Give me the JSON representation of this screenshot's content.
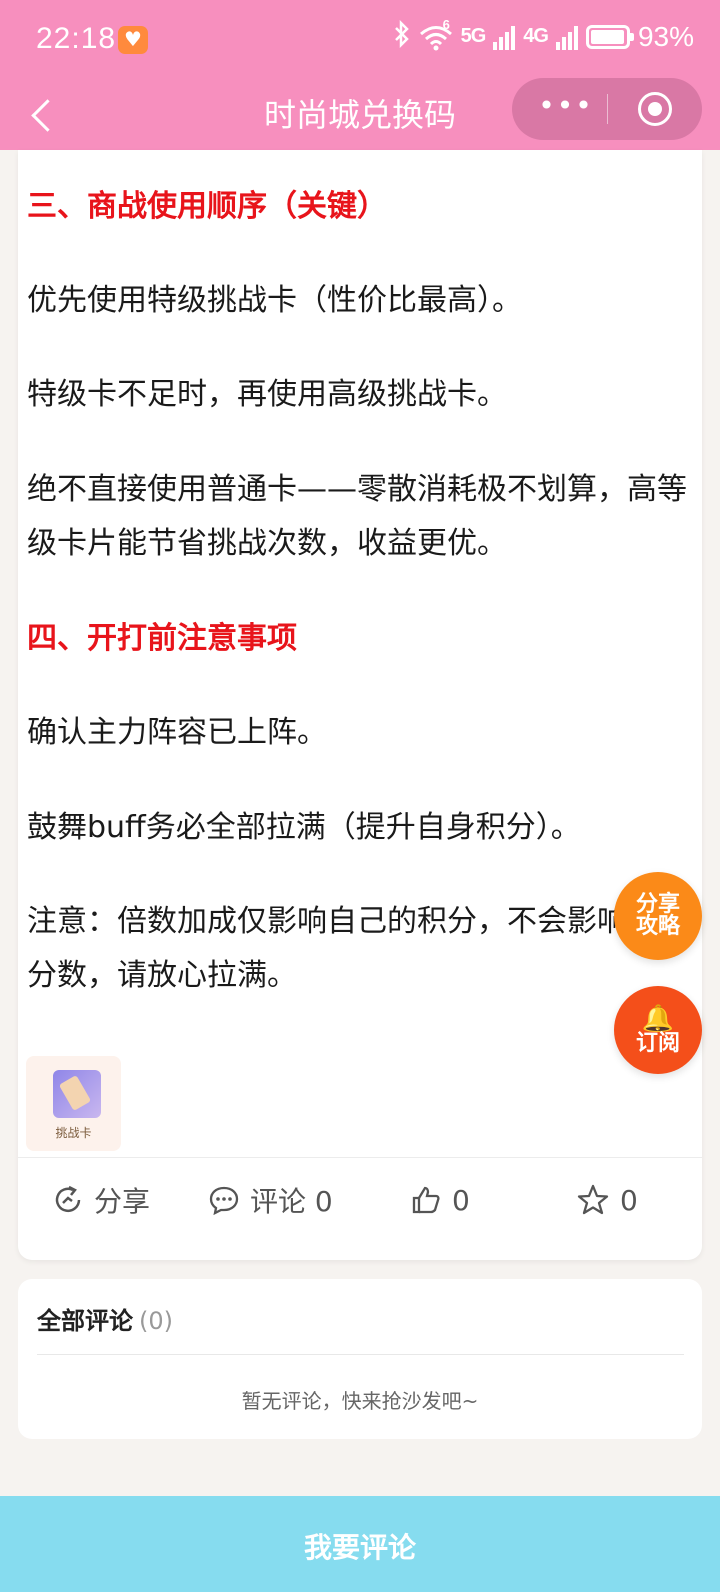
{
  "status_bar": {
    "time": "22:18",
    "wifi_label": "6",
    "signal_1": "5G",
    "signal_2": "4G",
    "battery_pct": "93%"
  },
  "nav": {
    "title": "时尚城兑换码",
    "more_label": "•••"
  },
  "article": {
    "paragraphs": [
      {
        "text": "三、商战使用顺序（关键）",
        "heading": true
      },
      {
        "text": "优先使用特级挑战卡（性价比最高）。",
        "heading": false
      },
      {
        "text": "特级卡不足时，再使用高级挑战卡。",
        "heading": false
      },
      {
        "text": "绝不直接使用普通卡——零散消耗极不划算，高等级卡片能节省挑战次数，收益更优。",
        "heading": false
      },
      {
        "text": "四、开打前注意事项",
        "heading": true
      },
      {
        "text": "确认主力阵容已上阵。",
        "heading": false
      },
      {
        "text": "鼓舞buff务必全部拉满（提升自身积分）。",
        "heading": false
      },
      {
        "text": "注意：倍数加成仅影响自己的积分，不会影响对手分数，请放心拉满。",
        "heading": false
      }
    ],
    "thumbnail_label": "挑战卡"
  },
  "actions": {
    "share": "分享",
    "comment": "评论 0",
    "like": "0",
    "favorite": "0"
  },
  "comments": {
    "title": "全部评论",
    "count": "(0)",
    "empty_text": "暂无评论，快来抢沙发吧~"
  },
  "fab": {
    "share_line1": "分享",
    "share_line2": "攻略",
    "subscribe": "订阅"
  },
  "bottom": {
    "label": "我要评论"
  },
  "colors": {
    "header": "#f78fbe",
    "heading_red": "#e8141b",
    "fab_orange": "#fb8a18",
    "fab_red": "#f44f1a",
    "bottom_bar": "#86dcef"
  }
}
